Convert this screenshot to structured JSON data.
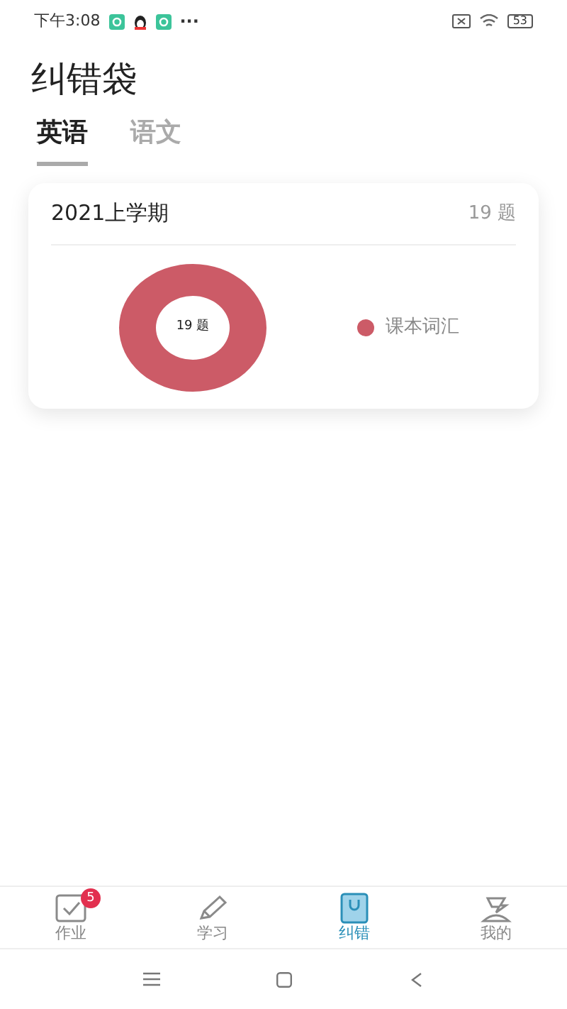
{
  "status_bar": {
    "time": "下午3:08",
    "more": "···",
    "battery": "53"
  },
  "header": {
    "title": "纠错袋"
  },
  "tabs": [
    {
      "label": "英语",
      "selected": true
    },
    {
      "label": "语文",
      "selected": false
    }
  ],
  "cards": [
    {
      "title": "2021上学期",
      "count": "19 题",
      "center_label": "19 题",
      "legend": [
        {
          "label": "课本词汇",
          "color": "#cc5b67"
        }
      ]
    }
  ],
  "bottom_nav": [
    {
      "kind": "homework",
      "label": "作业",
      "selected": false,
      "badge": "5"
    },
    {
      "kind": "study",
      "label": "学习",
      "selected": false
    },
    {
      "kind": "bag",
      "label": "纠错",
      "selected": true
    },
    {
      "kind": "me",
      "label": "我的",
      "selected": false
    }
  ]
}
